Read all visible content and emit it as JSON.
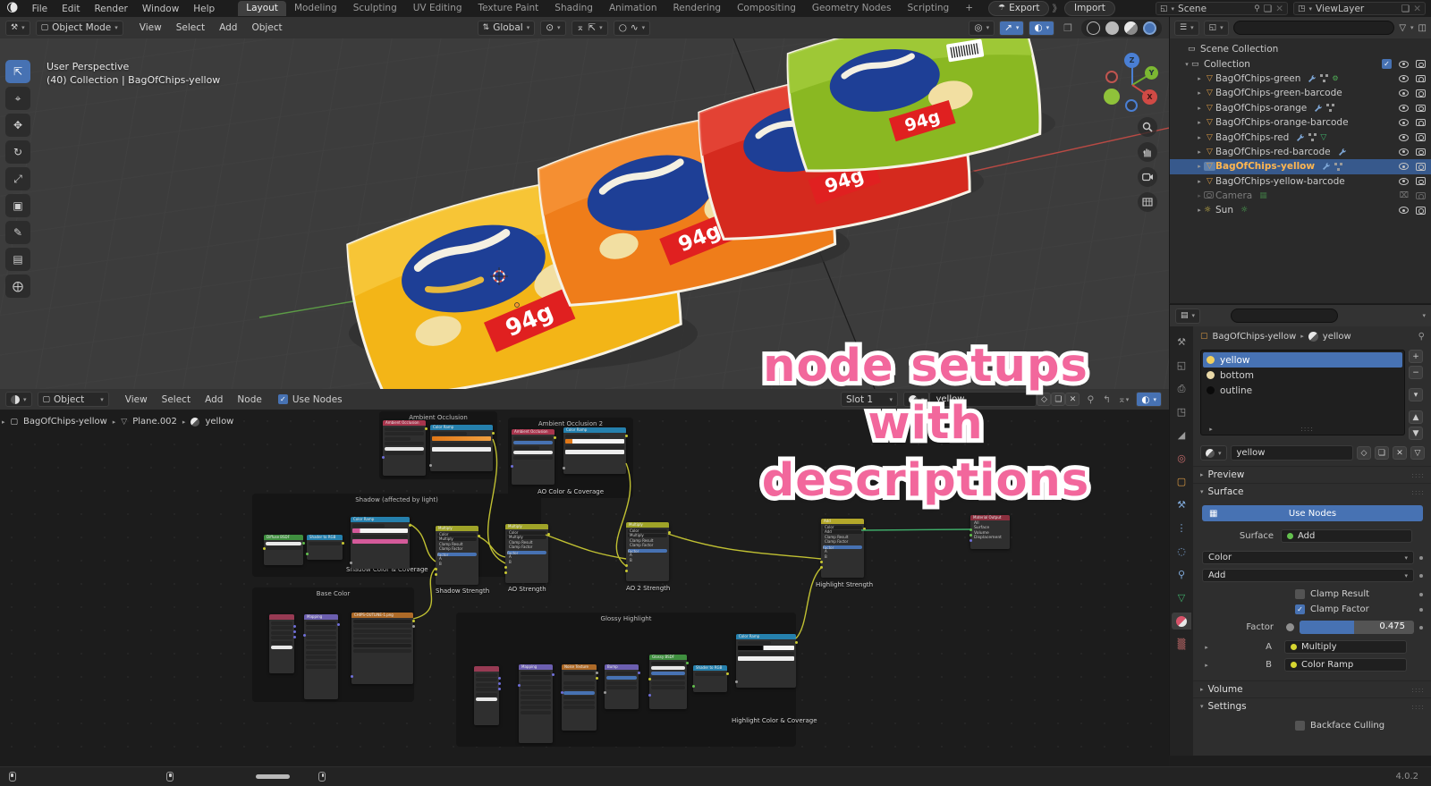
{
  "topbar": {
    "menus": [
      "File",
      "Edit",
      "Render",
      "Window",
      "Help"
    ],
    "tabs": [
      "Layout",
      "Modeling",
      "Sculpting",
      "UV Editing",
      "Texture Paint",
      "Shading",
      "Animation",
      "Rendering",
      "Compositing",
      "Geometry Nodes",
      "Scripting",
      "+"
    ],
    "export_label": "Export",
    "import_label": "Import",
    "scene": "Scene",
    "viewlayer": "ViewLayer"
  },
  "viewport": {
    "mode": "Object Mode",
    "menus": [
      "View",
      "Select",
      "Add",
      "Object"
    ],
    "orientation": "Global",
    "perspective_label": "User Perspective",
    "context_label": "(40) Collection | BagOfChips-yellow",
    "gizmo": {
      "z": "Z",
      "y": "Y",
      "x": "X"
    },
    "bag_tag": "94g"
  },
  "overlay": {
    "line1": "node setups with",
    "line2": "descriptions"
  },
  "outliner": {
    "root": "Scene Collection",
    "collection": "Collection",
    "items": [
      {
        "name": "BagOfChips-green"
      },
      {
        "name": "BagOfChips-green-barcode"
      },
      {
        "name": "BagOfChips-orange"
      },
      {
        "name": "BagOfChips-orange-barcode"
      },
      {
        "name": "BagOfChips-red"
      },
      {
        "name": "BagOfChips-red-barcode"
      },
      {
        "name": "BagOfChips-yellow"
      },
      {
        "name": "BagOfChips-yellow-barcode"
      },
      {
        "name": "Camera"
      },
      {
        "name": "Sun"
      }
    ]
  },
  "properties": {
    "breadcrumb": {
      "object": "BagOfChips-yellow",
      "material": "yellow"
    },
    "slots": [
      "yellow",
      "bottom",
      "outline"
    ],
    "material_name": "yellow",
    "sections": {
      "preview": "Preview",
      "surface": "Surface",
      "volume": "Volume",
      "settings": "Settings"
    },
    "surface": {
      "use_nodes": "Use Nodes",
      "surface_label": "Surface",
      "surface_value": "Add",
      "color_label": "Color",
      "blend_label": "Add",
      "clamp_result": "Clamp Result",
      "clamp_factor": "Clamp Factor",
      "factor_label": "Factor",
      "factor_value": "0.475",
      "a_label": "A",
      "a_value": "Multiply",
      "b_label": "B",
      "b_value": "Color Ramp",
      "backface": "Backface Culling"
    }
  },
  "shader": {
    "object_selector": "Object",
    "menus": [
      "View",
      "Select",
      "Add",
      "Node"
    ],
    "use_nodes": "Use Nodes",
    "slot": "Slot 1",
    "material": "yellow",
    "breadcrumb": [
      "BagOfChips-yellow",
      "Plane.002",
      "yellow"
    ],
    "frames": {
      "ao1": {
        "title": "Ambient Occlusion"
      },
      "ao2": {
        "title": "Ambient Occlusion 2",
        "caption": "AO Color & Coverage"
      },
      "shadow": {
        "title": "Shadow (affected by light)",
        "caption": "Shadow Color & Coverage"
      },
      "base": {
        "title": "Base Color"
      },
      "glossy": {
        "title": "Glossy Highlight",
        "caption": "Highlight Color & Coverage"
      }
    },
    "nodes": {
      "ao_a": "Ambient Occlusion",
      "ramp_a": "Color Ramp",
      "ao_b": "Ambient Occlusion",
      "ramp_b": "Color Ramp",
      "diffuse": "Diffuse BSDF",
      "shader_rgb": "Shader to RGB",
      "ramp_shadow": "Color Ramp",
      "texcoord": "Texture Coordinate",
      "mapping": "Mapping",
      "image": "CHIPS-OUTLINE-1.png",
      "texcoord2": "Texture Coordinate",
      "mapping2": "Mapping",
      "noise": "Noise Texture",
      "bump": "Bump",
      "glossy": "Glossy BSDF",
      "shader_rgb2": "Shader to RGB",
      "ramp_glossy": "Color Ramp",
      "mul1": "Multiply",
      "mul2": "Multiply",
      "mul3": "Multiply",
      "add": "Add",
      "output": "Material Output"
    },
    "captions": {
      "mul1": "Shadow Strength",
      "mul2": "AO Strength",
      "mul3": "AO 2 Strength",
      "add": "Highlight Strength"
    },
    "mix_rows": [
      "Color",
      "Multiply",
      "Clamp Result",
      "Clamp Factor",
      "Factor",
      "A",
      "B"
    ],
    "add_rows": [
      "Color",
      "Add",
      "Clamp Result",
      "Clamp Factor",
      "Factor",
      "A",
      "B"
    ],
    "output_sockets": [
      "All",
      "Surface",
      "Volume",
      "Displacement"
    ]
  },
  "statusbar": {
    "version": "4.0.2"
  },
  "colors": {
    "accent": "#4772b3",
    "wire": "#c0c032",
    "overlay_pink": "#f2679c",
    "selected_object_text": "#ffb650"
  }
}
